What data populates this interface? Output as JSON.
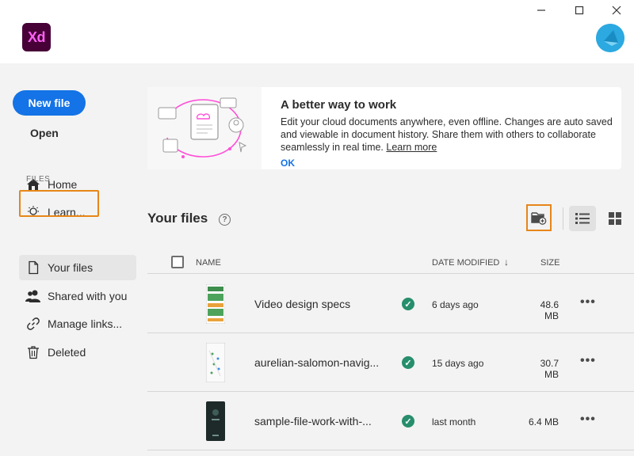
{
  "app": {
    "logo": "Xd"
  },
  "window": {
    "minimize_icon": "—",
    "maximize_icon": "☐",
    "close_icon": "✕"
  },
  "sidebar": {
    "new_file_label": "New file",
    "open_label": "Open",
    "section_label": "FILES",
    "nav": [
      {
        "label": "Home",
        "icon": "home-icon"
      },
      {
        "label": "Learn...",
        "icon": "lightbulb-icon"
      },
      {
        "label": "Your files",
        "icon": "document-icon",
        "selected": true
      },
      {
        "label": "Shared with you",
        "icon": "users-icon"
      },
      {
        "label": "Manage links...",
        "icon": "link-icon"
      },
      {
        "label": "Deleted",
        "icon": "trash-icon"
      }
    ]
  },
  "banner": {
    "title": "A better way to work",
    "text": "Edit your cloud documents anywhere, even offline. Changes are auto saved and viewable in document history. Share them with others to collaborate seamlessly in real time.",
    "link": "Learn more",
    "ok": "OK"
  },
  "files": {
    "title": "Your files",
    "help": "?",
    "columns": {
      "name": "NAME",
      "date": "DATE MODIFIED",
      "sort": "↓",
      "size": "SIZE"
    },
    "rows": [
      {
        "name": "Video design specs",
        "date": "6 days ago",
        "size": "48.6 MB",
        "more": "•••"
      },
      {
        "name": "aurelian-salomon-navig...",
        "date": "15 days ago",
        "size": "30.7 MB",
        "more": "•••"
      },
      {
        "name": "sample-file-work-with-...",
        "date": "last month",
        "size": "6.4 MB",
        "more": "•••"
      }
    ]
  },
  "colors": {
    "accent": "#1473e6",
    "highlight": "#e68619",
    "synced": "#268e6c",
    "xd_bg": "#470137",
    "xd_fg": "#ff61f6"
  }
}
